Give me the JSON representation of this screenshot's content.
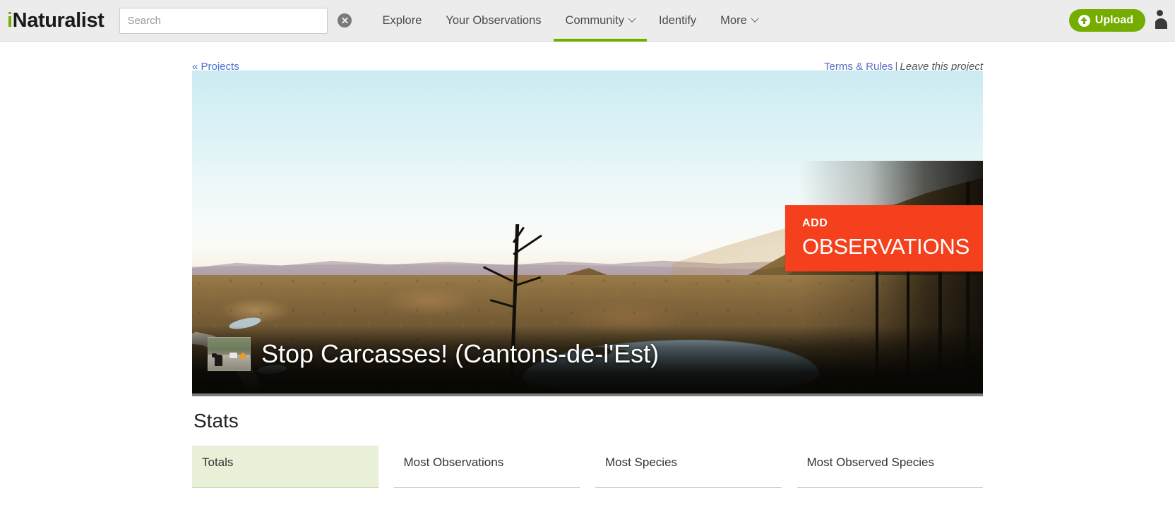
{
  "nav": {
    "logo_i": "i",
    "logo_rest": "Naturalist",
    "search_placeholder": "Search",
    "search_value": "",
    "clear_icon": "clear-circle-icon",
    "items": [
      {
        "label": "Explore",
        "has_caret": false,
        "active": false
      },
      {
        "label": "Your Observations",
        "has_caret": false,
        "active": false
      },
      {
        "label": "Community",
        "has_caret": true,
        "active": true
      },
      {
        "label": "Identify",
        "has_caret": false,
        "active": false
      },
      {
        "label": "More",
        "has_caret": true,
        "active": false
      }
    ],
    "upload_label": "Upload",
    "upload_icon": "upload-arrow-icon",
    "avatar_icon": "user-avatar-icon",
    "accent_green": "#74ac00"
  },
  "meta": {
    "back_link": "« Projects",
    "terms_link": "Terms & Rules",
    "separator": "|",
    "leave_link": "Leave this project"
  },
  "hero": {
    "ribbon_line1": "ADD",
    "ribbon_line2": "OBSERVATIONS",
    "ribbon_color": "#f4401d",
    "project_title": "Stop Carcasses! (Cantons-de-l'Est)",
    "project_icon": "project-thumbnail-moose-road"
  },
  "stats": {
    "heading": "Stats",
    "tabs": [
      {
        "label": "Totals",
        "active": true
      },
      {
        "label": "Most Observations",
        "active": false
      },
      {
        "label": "Most Species",
        "active": false
      },
      {
        "label": "Most Observed Species",
        "active": false
      }
    ],
    "active_tab_bg": "#e8f0d8"
  }
}
